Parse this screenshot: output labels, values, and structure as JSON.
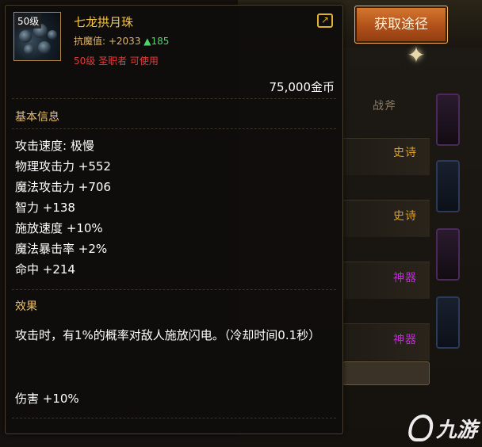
{
  "action": {
    "acquire_label": "获取途径"
  },
  "background": {
    "tab_label": "战斧",
    "rows": [
      {
        "label": "史诗",
        "color": "#d9a02a"
      },
      {
        "label": "史诗",
        "color": "#d9a02a"
      },
      {
        "label": "神器",
        "color": "#c02ad9"
      },
      {
        "label": "神器",
        "color": "#c02ad9"
      }
    ]
  },
  "item": {
    "level_tag": "50级",
    "name": "七龙拱月珠",
    "resist_label": "抗魔值: +2033",
    "resist_up": "▲185",
    "requirement": "50级 圣职者 可使用",
    "price": "75,000金币",
    "basic_title": "基本信息",
    "attributes": [
      "攻击速度: 极慢",
      "物理攻击力 +552",
      "魔法攻击力 +706",
      "智力 +138",
      "施放速度 +10%",
      "魔法暴击率 +2%",
      "命中 +214"
    ],
    "effect_title": "效果",
    "effect_text": "攻击时，有1%的概率对敌人施放闪电。（冷却时间0.1秒）",
    "damage": "伤害 +10%"
  },
  "watermark": "九游",
  "icons": [
    "share-icon",
    "sparkle-icon",
    "item-orb-icon",
    "watermark-logo-icon"
  ],
  "colors": {
    "name": "#f5c542",
    "stat": "#e0b46a",
    "up": "#4cd66a",
    "requirement": "#e23b3b",
    "section": "#e9c06b",
    "button": "#c0601f"
  }
}
